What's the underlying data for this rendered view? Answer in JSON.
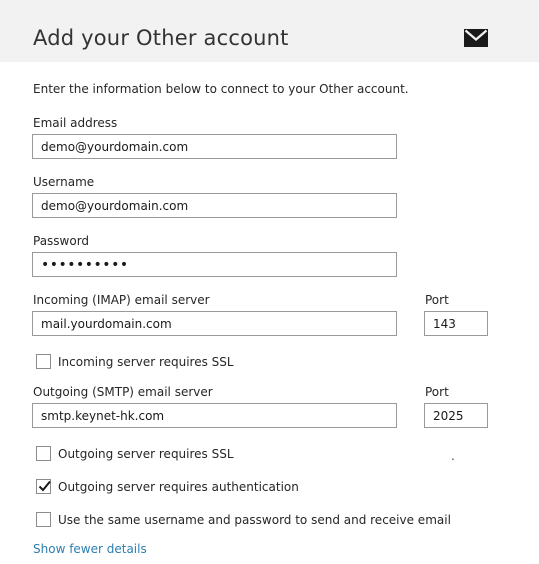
{
  "header": {
    "title": "Add your Other account",
    "icon": "mail-icon"
  },
  "intro": "Enter the information below to connect to your Other account.",
  "email": {
    "label": "Email address",
    "value": "demo@yourdomain.com"
  },
  "username": {
    "label": "Username",
    "value": "demo@yourdomain.com"
  },
  "password": {
    "label": "Password",
    "value": "••••••••••"
  },
  "incoming": {
    "label": "Incoming (IMAP) email server",
    "value": "mail.yourdomain.com",
    "port_label": "Port",
    "port_value": "143",
    "ssl_label": "Incoming server requires SSL",
    "ssl_checked": false
  },
  "outgoing": {
    "label": "Outgoing (SMTP) email server",
    "value": "smtp.keynet-hk.com",
    "port_label": "Port",
    "port_value": "2025",
    "ssl_label": "Outgoing server requires SSL",
    "ssl_checked": false,
    "auth_label": "Outgoing server requires authentication",
    "auth_checked": true,
    "same_cred_label": "Use the same username and password to send and receive email",
    "same_cred_checked": false
  },
  "stray_mark": ".",
  "fewer_details_link": "Show fewer details"
}
